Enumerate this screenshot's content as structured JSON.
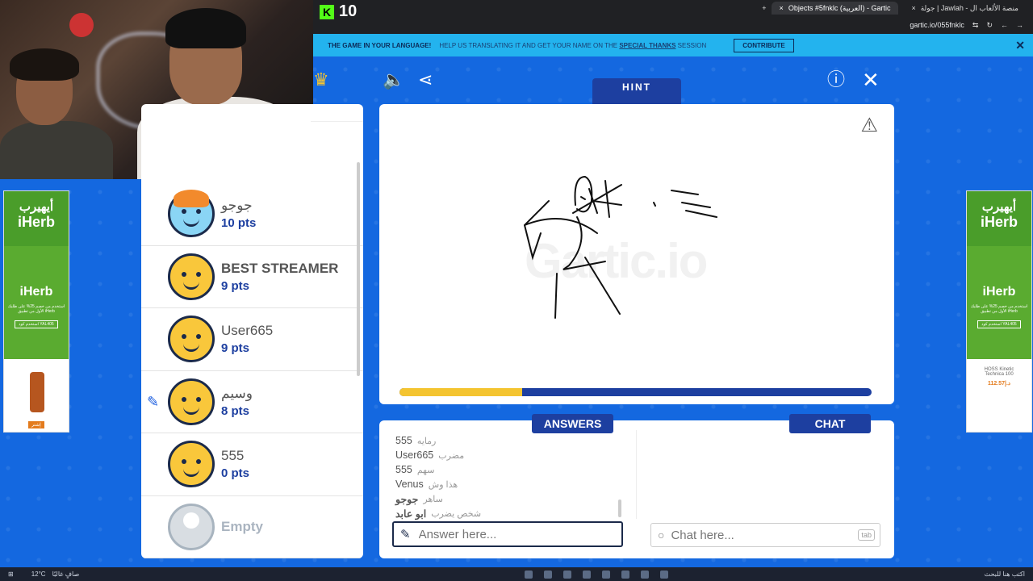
{
  "browser": {
    "tabs": [
      {
        "label": "Objects #5fnklc (العربية) - Gartic",
        "active": true
      },
      {
        "label": "جولة | Jawlah - منصة الألعاب ال",
        "active": false
      }
    ],
    "url": "gartic.io/055fnklc"
  },
  "stream": {
    "kick_count": "10"
  },
  "banner": {
    "title": "THE GAME IN YOUR LANGUAGE!",
    "subtitle": "HELP US TRANSLATING IT AND GET YOUR NAME ON THE",
    "link": "SPECIAL THANKS",
    "subtitle_end": "SESSION",
    "contribute": "CONTRIBUTE"
  },
  "game": {
    "hint_label": "HINT",
    "hint_value": "_____",
    "timer_progress": 0.26,
    "watermark": "Gartic.io"
  },
  "players": [
    {
      "name": "جوجو",
      "score": "10 pts",
      "avatar": "special",
      "drawing": false
    },
    {
      "name": "BEST STREAMER",
      "score": "9 pts",
      "avatar": "default",
      "drawing": false,
      "bold": true
    },
    {
      "name": "User665",
      "score": "9 pts",
      "avatar": "default",
      "drawing": false
    },
    {
      "name": "وسيم",
      "score": "8 pts",
      "avatar": "default",
      "drawing": true
    },
    {
      "name": "555",
      "score": "0 pts",
      "avatar": "default",
      "drawing": false
    },
    {
      "name": "Empty",
      "score": "",
      "avatar": "empty",
      "drawing": false
    }
  ],
  "answers_tab": "ANSWERS",
  "chat_tab": "CHAT",
  "answers": [
    {
      "user": "555",
      "text": "رمايه",
      "bold": false
    },
    {
      "user": "User665",
      "text": "مضرب",
      "bold": false
    },
    {
      "user": "555",
      "text": "سهم",
      "bold": false
    },
    {
      "user": "Venus",
      "text": "هذا وش",
      "bold": false
    },
    {
      "user": "جوجو",
      "text": "ساهر",
      "bold": true
    },
    {
      "user": "ابو عابد",
      "text": "شخص يضرب",
      "bold": true
    }
  ],
  "answer_placeholder": "Answer here...",
  "chat_placeholder": "Chat here...",
  "tab_key": "tab",
  "ads": {
    "brand_ar": "أيهيرب",
    "brand_en": "iHerb",
    "logo": "iHerb",
    "promo": "استخدم من خصم 25% على طلبك الأول من تطبيق iHerb",
    "code": "استخدم كود YAL405",
    "button": "إشتر",
    "price_text": "HOSS Kinetic Technica 100",
    "price": "112.57د.إ"
  },
  "taskbar": {
    "weather": "12°C",
    "weather_desc": "صافٍ غالبًا",
    "right_text": "اكتب هنا للبحث"
  }
}
